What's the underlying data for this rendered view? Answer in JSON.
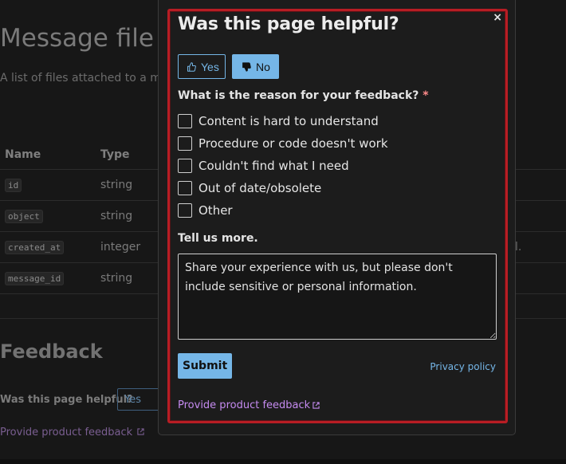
{
  "background": {
    "page_title": "Message file",
    "description": "A list of files attached to a m",
    "table": {
      "headers": [
        "Name",
        "Type"
      ],
      "rows": [
        {
          "name": "id",
          "type": "string",
          "note": ""
        },
        {
          "name": "object",
          "type": "string",
          "note": ""
        },
        {
          "name": "created_at",
          "type": "integer",
          "note": "l."
        },
        {
          "name": "message_id",
          "type": "string",
          "note": ""
        }
      ]
    },
    "feedback_heading": "Feedback",
    "helpful_question": "Was this page helpful?",
    "yes_label": "Yes",
    "product_feedback_link": "Provide product feedback"
  },
  "dialog": {
    "close_label": "×",
    "title": "Was this page helpful?",
    "yes_label": "Yes",
    "no_label": "No",
    "selected_vote": "No",
    "reason_question": "What is the reason for your feedback?",
    "required_marker": "*",
    "reasons": [
      {
        "label": "Content is hard to understand",
        "checked": false
      },
      {
        "label": "Procedure or code doesn't work",
        "checked": false
      },
      {
        "label": "Couldn't find what I need",
        "checked": false
      },
      {
        "label": "Out of date/obsolete",
        "checked": false
      },
      {
        "label": "Other",
        "checked": false
      }
    ],
    "tell_more_label": "Tell us more.",
    "textarea_placeholder": "Share your experience with us, but please don't include sensitive or personal information.",
    "submit_label": "Submit",
    "privacy_label": "Privacy policy",
    "product_feedback_label": "Provide product feedback"
  },
  "colors": {
    "accent": "#75b6e7",
    "link_purple": "#c58bf0",
    "focus_outline": "#b81d24",
    "background": "#171717"
  },
  "icons": {
    "yes_icon": "thumbs-up-outline-icon",
    "no_icon": "thumbs-down-filled-icon",
    "external_icon": "external-link-icon"
  }
}
